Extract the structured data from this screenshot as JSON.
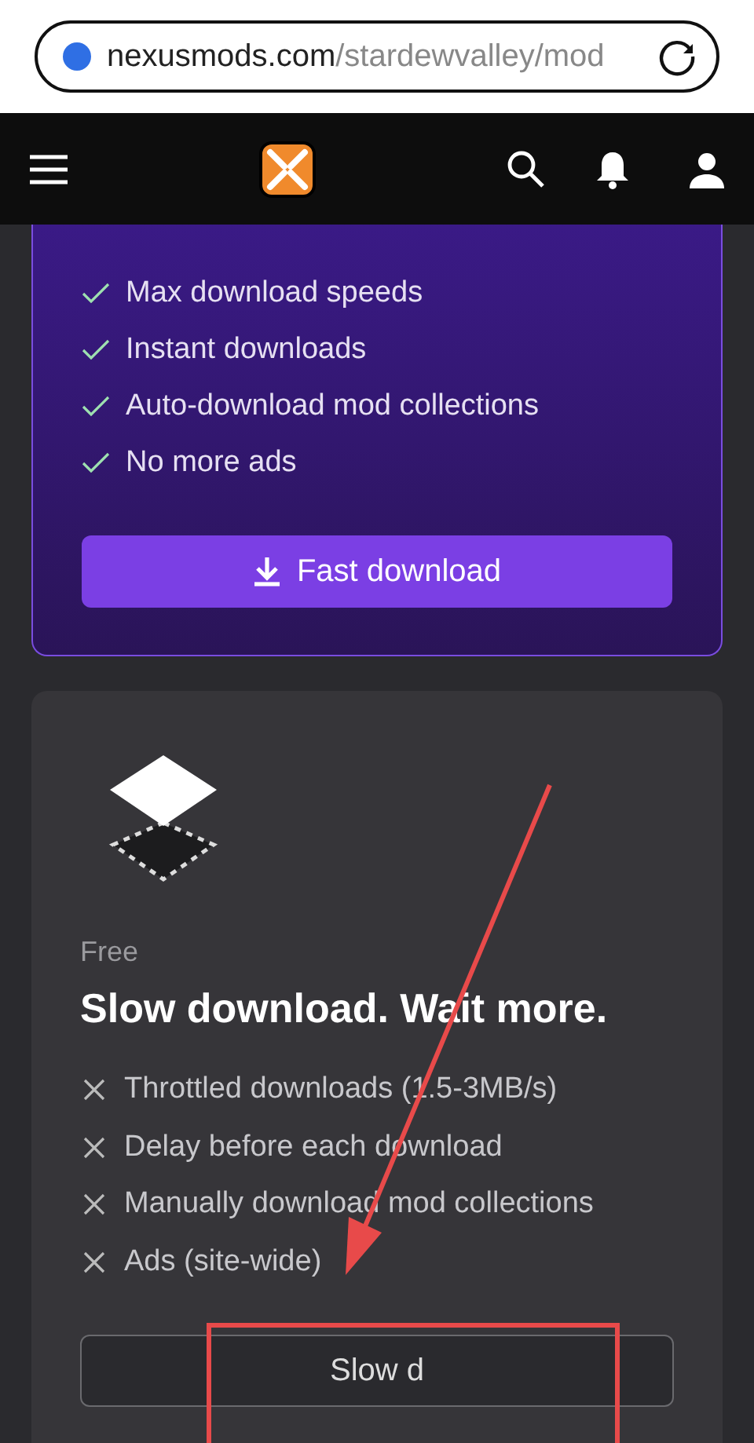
{
  "address_bar": {
    "domain": "nexusmods.com",
    "path": "/stardewvalley/mod"
  },
  "premium": {
    "features": [
      "Max download speeds",
      "Instant downloads",
      "Auto-download mod collections",
      "No more ads"
    ],
    "button": "Fast download"
  },
  "free": {
    "tier": "Free",
    "title": "Slow download. Wait more.",
    "limits": [
      "Throttled downloads (1.5-3MB/s)",
      "Delay before each download",
      "Manually download mod collections",
      "Ads (site-wide)"
    ],
    "button": "Slow d"
  }
}
